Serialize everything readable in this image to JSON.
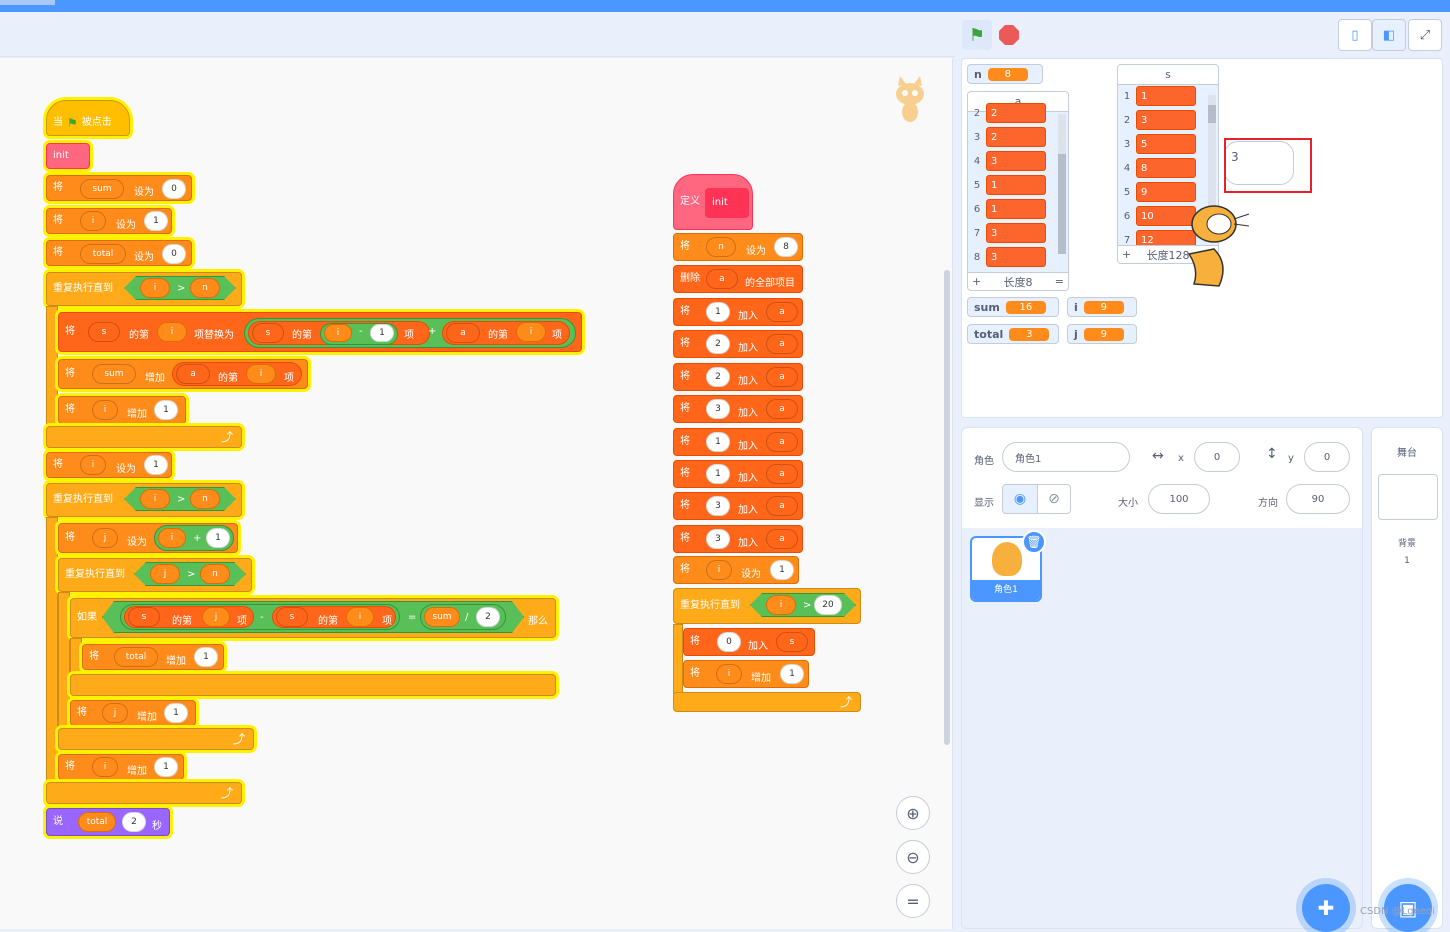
{
  "toolbar": {
    "flag_icon": "green-flag-icon",
    "stop_icon": "stop-icon",
    "layout_small": "small-stage-icon",
    "layout_large": "large-stage-icon",
    "fullscreen": "fullscreen-icon"
  },
  "script1": {
    "hat_when": "当",
    "hat_clicked": "被点击",
    "init": "init",
    "set": "将",
    "to": "设为",
    "change": "增加",
    "repeat_until": "重复执行直到",
    "of_item": "的第",
    "item": "项",
    "replace_item": "项替换为",
    "if": "如果",
    "then": "那么",
    "say": "说",
    "secs": "秒",
    "v_sum": "sum",
    "v_i": "i",
    "v_total": "total",
    "v_n": "n",
    "v_j": "j",
    "l_s": "s",
    "l_a": "a",
    "zero": "0",
    "one": "1",
    "two": "2",
    "gt": ">",
    "plus": "+",
    "minus": "-",
    "div": "/",
    "eq": "="
  },
  "script2": {
    "define": "定义",
    "init": "init",
    "set": "将",
    "to": "设为",
    "delete_all": "删除",
    "all_items": "的全部项目",
    "add": "加入",
    "change": "增加",
    "repeat_until": "重复执行直到",
    "v_n": "n",
    "v_i": "i",
    "l_a": "a",
    "l_s": "s",
    "eight": "8",
    "one": "1",
    "zero": "0",
    "twenty": "20",
    "gt": ">",
    "adds": [
      "1",
      "2",
      "2",
      "3",
      "1",
      "1",
      "3",
      "3"
    ]
  },
  "stage": {
    "n": {
      "name": "n",
      "value": "8"
    },
    "list_a": {
      "name": "a",
      "rows": [
        [
          "2",
          "2"
        ],
        [
          "3",
          "2"
        ],
        [
          "4",
          "3"
        ],
        [
          "5",
          "1"
        ],
        [
          "6",
          "1"
        ],
        [
          "7",
          "3"
        ],
        [
          "8",
          "3"
        ]
      ],
      "footer_plus": "+",
      "length": "长度8",
      "footer_eq": "="
    },
    "list_s": {
      "name": "s",
      "rows": [
        [
          "1",
          "1"
        ],
        [
          "2",
          "3"
        ],
        [
          "3",
          "5"
        ],
        [
          "4",
          "8"
        ],
        [
          "5",
          "9"
        ],
        [
          "6",
          "10"
        ],
        [
          "7",
          "12"
        ]
      ],
      "footer_plus": "+",
      "length": "长度128",
      "footer_eq": "="
    },
    "speech": "3",
    "sum": {
      "name": "sum",
      "value": "16"
    },
    "i": {
      "name": "i",
      "value": "9"
    },
    "total": {
      "name": "total",
      "value": "3"
    },
    "j": {
      "name": "j",
      "value": "9"
    }
  },
  "sprite_panel": {
    "sprite_label": "角色",
    "sprite_name": "角色1",
    "x_label": "x",
    "x_value": "0",
    "y_label": "y",
    "y_value": "0",
    "show_label": "显示",
    "size_label": "大小",
    "size_value": "100",
    "dir_label": "方向",
    "dir_value": "90",
    "thumb_name": "角色1"
  },
  "stage_panel": {
    "title": "舞台",
    "backdrop_label": "背景",
    "backdrop_count": "1"
  },
  "watermark": "CSDN @Lgeeqi"
}
